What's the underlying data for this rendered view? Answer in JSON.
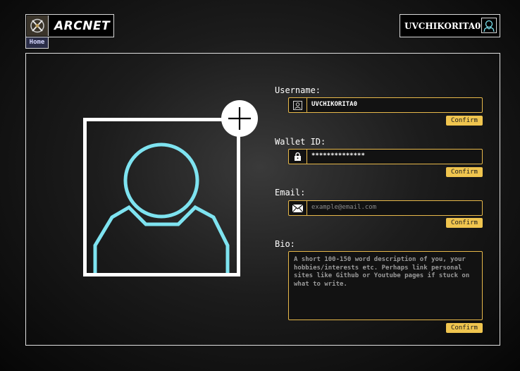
{
  "header": {
    "logo_text": "ARCNET",
    "home_label": "Home",
    "user_name": "UVCHIKORITA0",
    "logo_icon": "crossed-swords-emblem-icon",
    "user_icon": "user-icon"
  },
  "profile": {
    "avatar_icon": "user-silhouette-icon",
    "add_photo_icon": "plus-icon"
  },
  "form": {
    "username": {
      "label": "Username:",
      "value": "UVCHIKORITA0",
      "icon": "user-card-icon",
      "confirm_label": "Confirm"
    },
    "wallet": {
      "label": "Wallet ID:",
      "value": "**************",
      "icon": "lock-icon",
      "confirm_label": "Confirm"
    },
    "email": {
      "label": "Email:",
      "placeholder": "example@email.com",
      "icon": "envelope-icon",
      "confirm_label": "Confirm"
    },
    "bio": {
      "label": "Bio:",
      "placeholder": "A short 100-150 word description of you, your hobbies/interests etc. Perhaps link personal sites like Github or Youtube pages if stuck on what to write.",
      "confirm_label": "Confirm"
    }
  },
  "colors": {
    "accent": "#f0c54f",
    "field_border": "#e7b84a",
    "avatar_stroke": "#7ee3f0",
    "home_bg": "#2a2d47"
  }
}
